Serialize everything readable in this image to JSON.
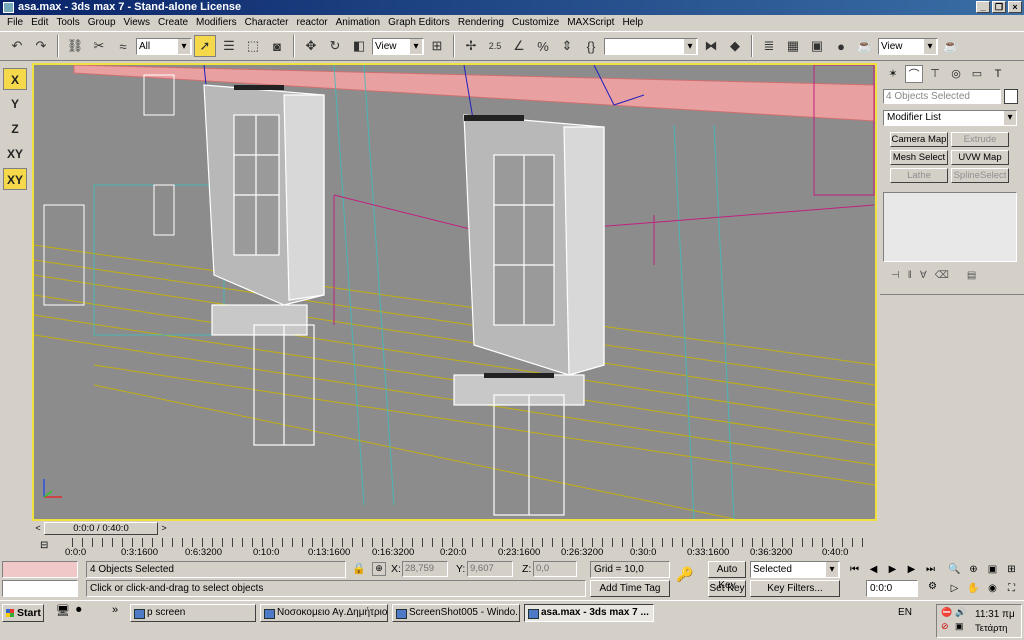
{
  "window": {
    "title": "asa.max - 3ds max 7 - Stand-alone License"
  },
  "menu": [
    "File",
    "Edit",
    "Tools",
    "Group",
    "Views",
    "Create",
    "Modifiers",
    "Character",
    "reactor",
    "Animation",
    "Graph Editors",
    "Rendering",
    "Customize",
    "MAXScript",
    "Help"
  ],
  "toolbar": {
    "selection_filter": "All",
    "ref_coord": "View",
    "named_selection": "",
    "render_view": "View",
    "snap_angle": "2.5"
  },
  "axis_constraints": [
    "X",
    "Y",
    "Z",
    "XY",
    "XY"
  ],
  "command_panel": {
    "object_name": "4 Objects Selected",
    "modifier_list": "Modifier List",
    "modifier_buttons": [
      {
        "label": "Camera Map",
        "enabled": true
      },
      {
        "label": "Extrude",
        "enabled": false
      },
      {
        "label": "Mesh Select",
        "enabled": true
      },
      {
        "label": "UVW Map",
        "enabled": true
      },
      {
        "label": "Lathe",
        "enabled": false
      },
      {
        "label": "SplineSelect",
        "enabled": false
      }
    ]
  },
  "timeline": {
    "slider_label": "0:0:0 / 0:40:0",
    "prev": "<",
    "next": ">",
    "ticks": [
      "0:0:0",
      "0:3:1600",
      "0:6:3200",
      "0:10:0",
      "0:13:1600",
      "0:16:3200",
      "0:20:0",
      "0:23:1600",
      "0:26:3200",
      "0:30:0",
      "0:33:1600",
      "0:36:3200",
      "0:40:0"
    ]
  },
  "status": {
    "selection_info": "4 Objects Selected",
    "prompt": "Click or click-and-drag to select objects",
    "x_label": "X:",
    "x_value": "28,759",
    "y_label": "Y:",
    "y_value": "9,607",
    "z_label": "Z:",
    "z_value": "0,0",
    "grid": "Grid = 10,0",
    "add_time_tag": "Add Time Tag",
    "auto_key": "Auto Key",
    "set_key": "Set Key",
    "key_mode": "Selected",
    "key_filters": "Key Filters...",
    "current_time": "0:0:0"
  },
  "taskbar": {
    "start": "Start",
    "tasks": [
      {
        "label": "p screen",
        "active": false
      },
      {
        "label": "Νοσοκομειο Αγ.Δημήτριος",
        "active": false
      },
      {
        "label": "ScreenShot005 - Windo...",
        "active": false
      },
      {
        "label": "asa.max - 3ds max 7 ...",
        "active": true
      }
    ],
    "language": "EN",
    "time": "11:31 πμ",
    "day": "Τετάρτη",
    "more": "»"
  },
  "colors": {
    "viewport_bg": "#8c8c8c",
    "active_border": "#f0e040",
    "highlight": "#f5d94a",
    "title_blue": "#0a246a"
  }
}
